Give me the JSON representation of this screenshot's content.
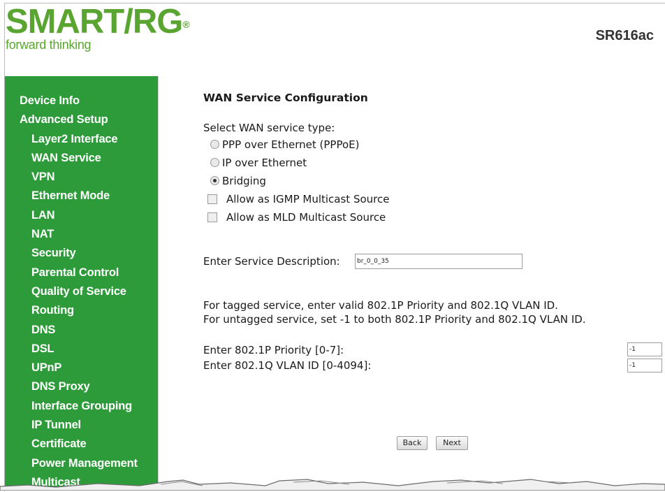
{
  "header": {
    "brand": "SMART/RG",
    "trademark": "®",
    "tagline": "forward thinking",
    "model": "SR616ac"
  },
  "colors": {
    "brand_green": "#5aa531",
    "sidebar_green": "#2e9b3a"
  },
  "sidebar": {
    "items": [
      {
        "label": "Device Info",
        "level": 1
      },
      {
        "label": "Advanced Setup",
        "level": 1
      },
      {
        "label": "Layer2 Interface",
        "level": 2
      },
      {
        "label": "WAN Service",
        "level": 2
      },
      {
        "label": "VPN",
        "level": 2
      },
      {
        "label": "Ethernet Mode",
        "level": 2
      },
      {
        "label": "LAN",
        "level": 2
      },
      {
        "label": "NAT",
        "level": 2
      },
      {
        "label": "Security",
        "level": 2
      },
      {
        "label": "Parental Control",
        "level": 2
      },
      {
        "label": "Quality of Service",
        "level": 2
      },
      {
        "label": "Routing",
        "level": 2
      },
      {
        "label": "DNS",
        "level": 2
      },
      {
        "label": "DSL",
        "level": 2
      },
      {
        "label": "UPnP",
        "level": 2
      },
      {
        "label": "DNS Proxy",
        "level": 2
      },
      {
        "label": "Interface Grouping",
        "level": 2
      },
      {
        "label": "IP Tunnel",
        "level": 2
      },
      {
        "label": "Certificate",
        "level": 2
      },
      {
        "label": "Power Management",
        "level": 2
      },
      {
        "label": "Multicast",
        "level": 2
      }
    ]
  },
  "main": {
    "title": "WAN Service Configuration",
    "select_label": "Select WAN service type:",
    "service_types": [
      {
        "label": "PPP over Ethernet (PPPoE)",
        "selected": false
      },
      {
        "label": "IP over Ethernet",
        "selected": false
      },
      {
        "label": "Bridging",
        "selected": true
      }
    ],
    "checkboxes": [
      {
        "label": "Allow as IGMP Multicast Source",
        "checked": false
      },
      {
        "label": "Allow as MLD Multicast Source",
        "checked": false
      }
    ],
    "description_label": "Enter Service Description:",
    "description_value": "br_0_0_35",
    "vlan_info_line1": "For tagged service, enter valid 802.1P Priority and 802.1Q VLAN ID.",
    "vlan_info_line2": "For untagged service, set -1 to both 802.1P Priority and 802.1Q VLAN ID.",
    "priority_label": "Enter 802.1P Priority [0-7]:",
    "priority_value": "-1",
    "vlan_label": "Enter 802.1Q VLAN ID [0-4094]:",
    "vlan_value": "-1",
    "back_label": "Back",
    "next_label": "Next"
  }
}
